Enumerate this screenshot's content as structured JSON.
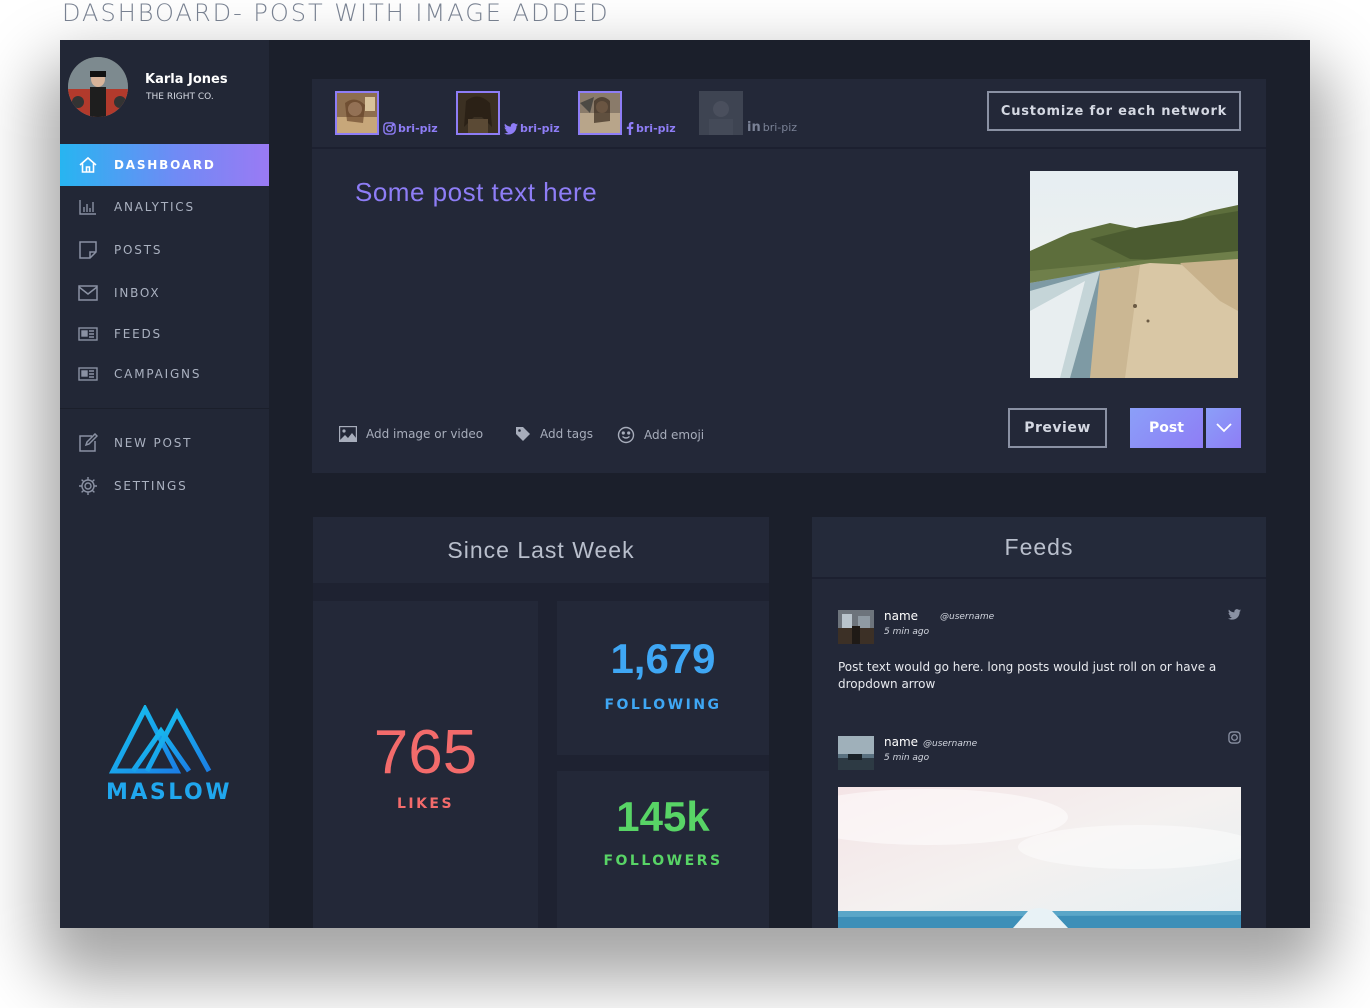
{
  "page_title": "DASHBOARD- POST WITH IMAGE ADDED",
  "user": {
    "name": "Karla Jones",
    "company": "THE RIGHT CO."
  },
  "nav": [
    {
      "label": "DASHBOARD",
      "icon": "home-icon",
      "active": true
    },
    {
      "label": "ANALYTICS",
      "icon": "bar-chart-icon"
    },
    {
      "label": "POSTS",
      "icon": "note-icon"
    },
    {
      "label": "INBOX",
      "icon": "envelope-icon"
    },
    {
      "label": "FEEDS",
      "icon": "newspaper-icon"
    },
    {
      "label": "CAMPAIGNS",
      "icon": "newspaper-icon"
    },
    {
      "label": "NEW POST",
      "icon": "edit-icon"
    },
    {
      "label": "SETTINGS",
      "icon": "gear-icon"
    }
  ],
  "logo_text": "MASLOW",
  "composer": {
    "accounts": [
      {
        "network": "instagram",
        "icon": "instagram-icon",
        "handle": "bri-piz"
      },
      {
        "network": "twitter",
        "icon": "twitter-icon",
        "handle": "bri-piz"
      },
      {
        "network": "facebook",
        "icon": "facebook-icon",
        "handle": "bri-piz"
      },
      {
        "network": "linkedin",
        "icon": "linkedin-icon",
        "handle": "bri-piz"
      }
    ],
    "customize_label": "Customize for each network",
    "post_text": "Some post text here",
    "tools": {
      "add_image": "Add image or video",
      "add_tags": "Add tags",
      "add_emoji": "Add emoji"
    },
    "preview_label": "Preview",
    "post_label": "Post"
  },
  "stats": {
    "title": "Since Last Week",
    "likes": {
      "value": "765",
      "label": "LIKES"
    },
    "following": {
      "value": "1,679",
      "label": "FOLLOWING"
    },
    "followers": {
      "value": "145k",
      "label": "FOLLOWERS"
    }
  },
  "feeds": {
    "title": "Feeds",
    "items": [
      {
        "name": "name",
        "username": "@username",
        "time": "5 min ago",
        "network_icon": "twitter-icon",
        "text": "Post text would go here. long posts would just roll on or have a dropdown arrow"
      },
      {
        "name": "name",
        "username": "@username",
        "time": "5 min ago",
        "network_icon": "instagram-icon"
      }
    ]
  },
  "colors": {
    "accent_purple": "#8e7df6",
    "accent_blue": "#27b5f1",
    "likes": "#f36b6b",
    "following": "#3fa7f4",
    "followers": "#58d466"
  }
}
